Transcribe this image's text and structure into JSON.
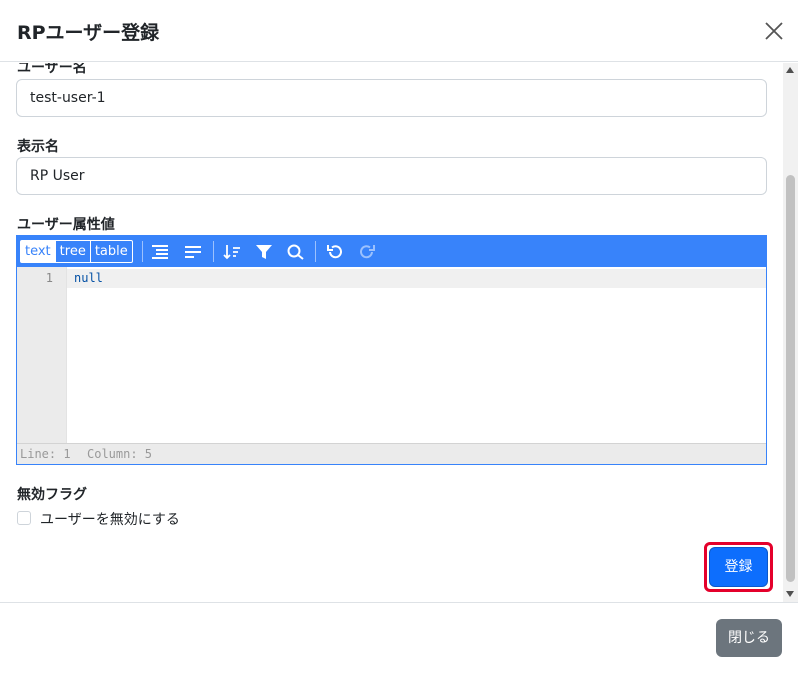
{
  "modal": {
    "title": "RPユーザー登録",
    "close_icon": "close-icon"
  },
  "form": {
    "username": {
      "label": "ユーザー名",
      "value": "test-user-1"
    },
    "display_name": {
      "label": "表示名",
      "value": "RP User"
    },
    "attributes": {
      "label": "ユーザー属性値",
      "editor": {
        "modes": [
          "text",
          "tree",
          "table"
        ],
        "active_mode": "text",
        "toolbar_icons": [
          "format-icon",
          "compact-icon",
          "sort-icon",
          "filter-icon",
          "search-icon",
          "undo-icon",
          "redo-icon"
        ],
        "line_numbers": [
          "1"
        ],
        "content": "null",
        "status_line": "Line: 1",
        "status_column": "Column: 5"
      }
    },
    "disabled_flag": {
      "label": "無効フラグ",
      "checkbox_label": "ユーザーを無効にする",
      "checked": false
    },
    "register_label": "登録"
  },
  "footer": {
    "close_label": "閉じる"
  },
  "colors": {
    "primary": "#0d6efd",
    "editor_accent": "#3883fa",
    "secondary": "#6c757d",
    "highlight": "#e4002b"
  }
}
